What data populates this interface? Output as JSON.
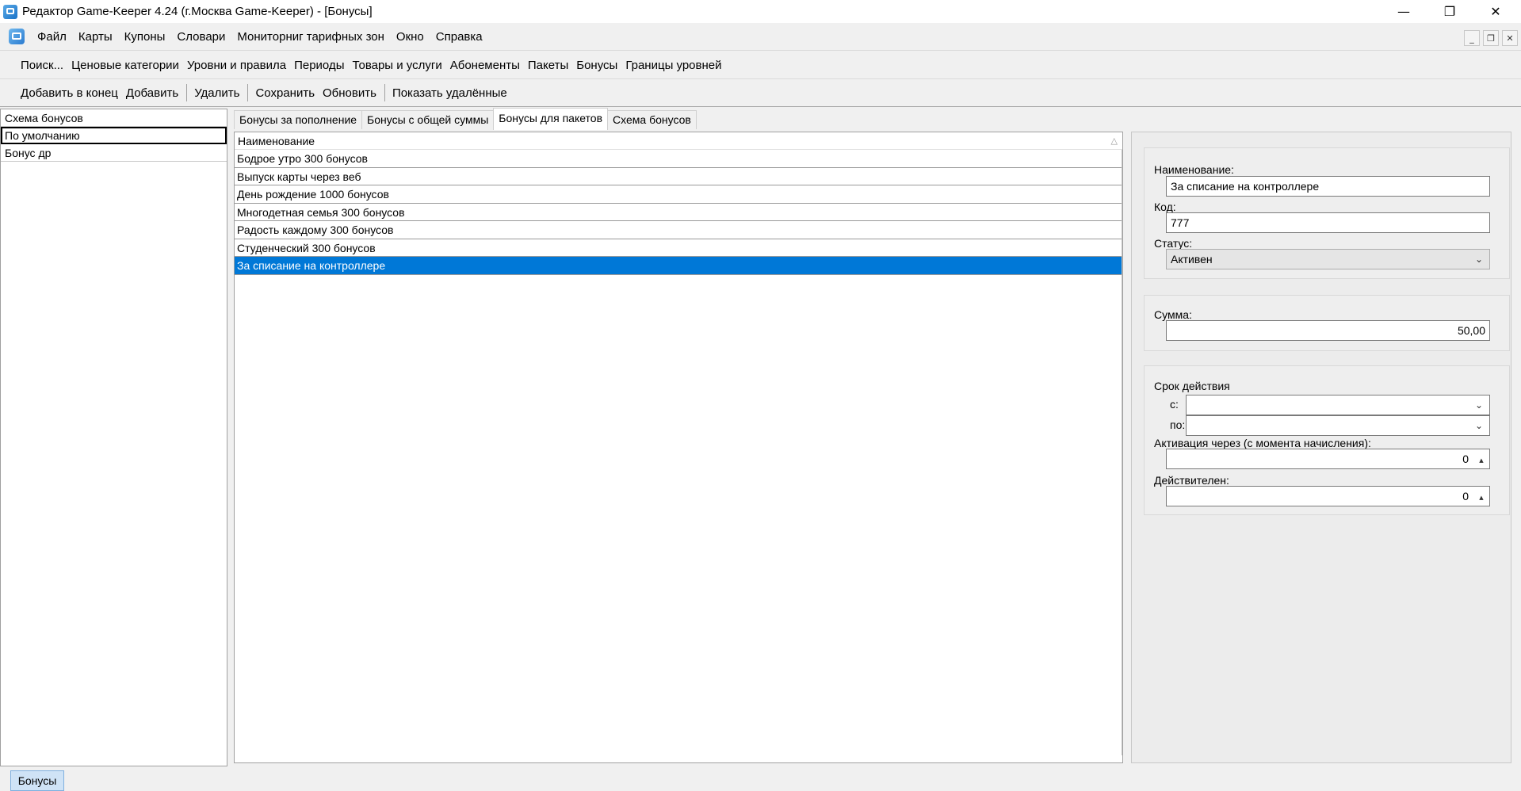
{
  "window": {
    "title": "Редактор Game-Keeper 4.24 (г.Москва Game-Keeper) - [Бонусы]",
    "minimize_icon": "minimize-icon",
    "maximize_icon": "restore-icon",
    "close_icon": "close-icon"
  },
  "menu": {
    "items": [
      "Файл",
      "Карты",
      "Купоны",
      "Словари",
      "Мониторниг тарифных зон",
      "Окно",
      "Справка"
    ]
  },
  "nav_toolbar": {
    "items": [
      "Поиск...",
      "Ценовые категории",
      "Уровни и правила",
      "Периоды",
      "Товары и услуги",
      "Абонементы",
      "Пакеты",
      "Бонусы",
      "Границы уровней"
    ]
  },
  "action_toolbar": {
    "add_end": "Добавить в конец",
    "add": "Добавить",
    "delete": "Удалить",
    "save": "Сохранить",
    "refresh": "Обновить",
    "show_deleted": "Показать удалённые"
  },
  "schemes": {
    "header": "Схема бонусов",
    "items": [
      "По умолчанию",
      "Бонус др"
    ]
  },
  "tabs": [
    "Бонусы за пополнение",
    "Бонусы с общей суммы",
    "Бонусы для пакетов",
    "Схема бонусов"
  ],
  "active_tab_index": 2,
  "grid": {
    "column": "Наименование",
    "rows": [
      "Бодрое утро 300 бонусов",
      "Выпуск карты через веб",
      "День рождение 1000 бонусов",
      "Многодетная семья 300 бонусов",
      "Радость каждому 300 бонусов",
      "Студенческий 300 бонусов",
      "За списание на контроллере"
    ],
    "selected_index": 6
  },
  "details": {
    "name_label": "Наименование:",
    "name_value": "За списание на контроллере",
    "code_label": "Код:",
    "code_value": "777",
    "status_label": "Статус:",
    "status_value": "Активен",
    "sum_label": "Сумма:",
    "sum_value": "50,00",
    "validity_label": "Срок действия",
    "from_label": "с:",
    "to_label": "по:",
    "activation_label": "Активация через (с момента начисления):",
    "activation_value": "0",
    "valid_label": "Действителен:",
    "valid_value": "0"
  },
  "statusbar": {
    "tab": "Бонусы"
  },
  "colors": {
    "selection": "#0078d7",
    "status_tab_bg": "#cfe3f6"
  }
}
